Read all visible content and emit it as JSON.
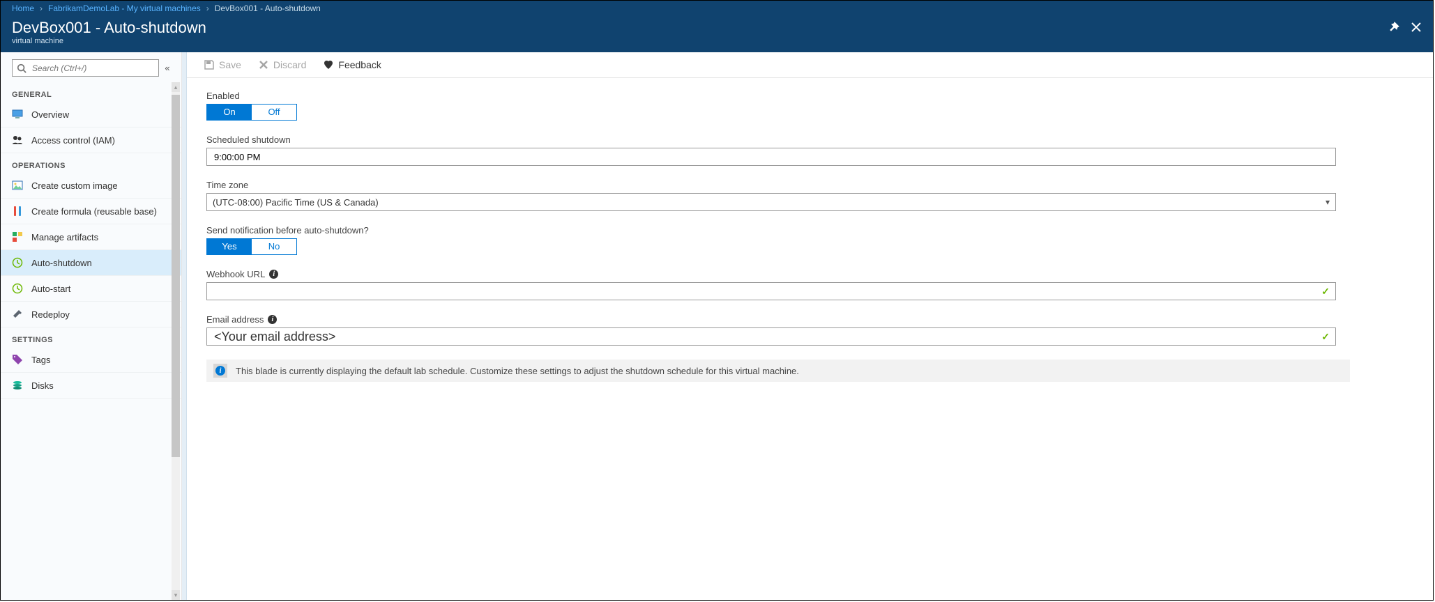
{
  "breadcrumb": {
    "home": "Home",
    "lab": "FabrikamDemoLab - My virtual machines",
    "current": "DevBox001 - Auto-shutdown"
  },
  "titlebar": {
    "title": "DevBox001 - Auto-shutdown",
    "subtitle": "virtual machine"
  },
  "search": {
    "placeholder": "Search (Ctrl+/)"
  },
  "sidebar": {
    "group_general": "GENERAL",
    "overview": "Overview",
    "iam": "Access control (IAM)",
    "group_operations": "OPERATIONS",
    "create_image": "Create custom image",
    "create_formula": "Create formula (reusable base)",
    "manage_artifacts": "Manage artifacts",
    "auto_shutdown": "Auto-shutdown",
    "auto_start": "Auto-start",
    "redeploy": "Redeploy",
    "group_settings": "SETTINGS",
    "tags": "Tags",
    "disks": "Disks"
  },
  "toolbar": {
    "save": "Save",
    "discard": "Discard",
    "feedback": "Feedback"
  },
  "form": {
    "enabled_label": "Enabled",
    "enabled_on": "On",
    "enabled_off": "Off",
    "scheduled_label": "Scheduled shutdown",
    "scheduled_value": "9:00:00 PM",
    "tz_label": "Time zone",
    "tz_value": "(UTC-08:00) Pacific Time (US & Canada)",
    "notify_label": "Send notification before auto-shutdown?",
    "notify_yes": "Yes",
    "notify_no": "No",
    "webhook_label": "Webhook URL",
    "webhook_value": "",
    "email_label": "Email address",
    "email_value": "<Your email address>",
    "banner": "This blade is currently displaying the default lab schedule. Customize these settings to adjust the shutdown schedule for this virtual machine."
  }
}
